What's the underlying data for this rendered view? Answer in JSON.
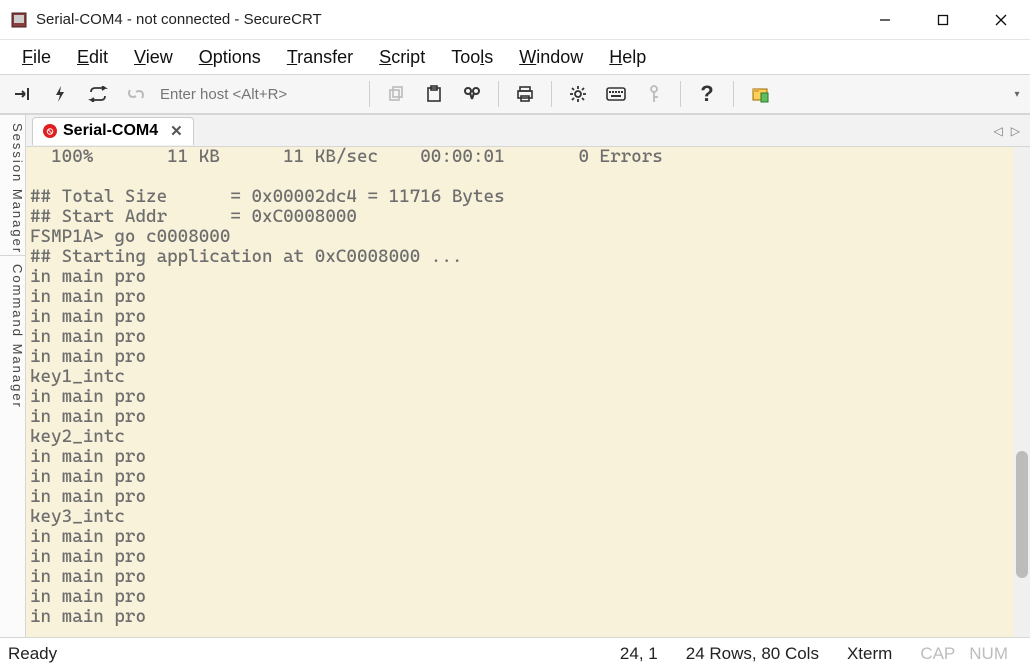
{
  "window": {
    "title": "Serial-COM4 - not connected - SecureCRT"
  },
  "menu": {
    "file": "File",
    "edit": "Edit",
    "view": "View",
    "options": "Options",
    "transfer": "Transfer",
    "script": "Script",
    "tools": "Tools",
    "windowm": "Window",
    "help": "Help"
  },
  "toolbar": {
    "host_placeholder": "Enter host <Alt+R>"
  },
  "side": {
    "session": "Session Manager",
    "command": "Command Manager"
  },
  "tab": {
    "label": "Serial-COM4"
  },
  "terminal": {
    "lines": [
      "  100%       11 KB      11 KB/sec    00:00:01       0 Errors",
      "",
      "## Total Size      = 0x00002dc4 = 11716 Bytes",
      "## Start Addr      = 0xC0008000",
      "FSMP1A> go c0008000",
      "## Starting application at 0xC0008000 ...",
      "in main pro",
      "in main pro",
      "in main pro",
      "in main pro",
      "in main pro",
      "key1_intc",
      "in main pro",
      "in main pro",
      "key2_intc",
      "in main pro",
      "in main pro",
      "in main pro",
      "key3_intc",
      "in main pro",
      "in main pro",
      "in main pro",
      "in main pro",
      "in main pro"
    ]
  },
  "status": {
    "ready": "Ready",
    "cursor": "24,   1",
    "size": "24 Rows, 80 Cols",
    "term": "Xterm",
    "cap": "CAP",
    "num": "NUM"
  }
}
